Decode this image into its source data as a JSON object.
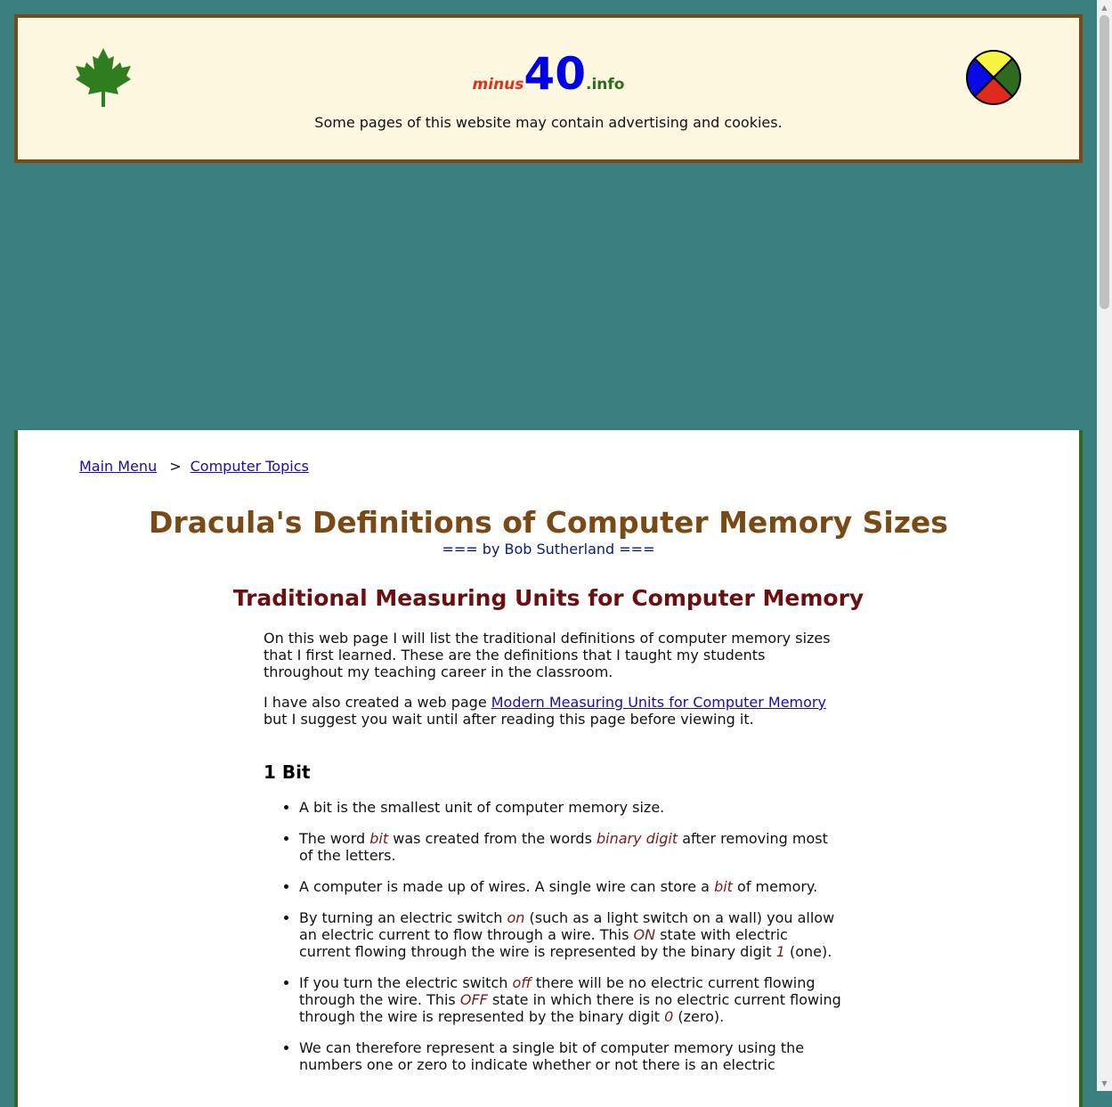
{
  "header": {
    "logo_minus": "minus",
    "logo_forty": "40",
    "logo_info": ".info",
    "notice": "Some pages of this website may contain advertising and cookies.",
    "left_icon": "maple-leaf-icon",
    "right_icon": "medicine-wheel-icon"
  },
  "breadcrumb": {
    "main_menu": "Main Menu",
    "separator": ">",
    "computer_topics": "Computer Topics"
  },
  "article": {
    "title": "Dracula's Definitions of Computer Memory Sizes",
    "byline": "=== by Bob Sutherland ===",
    "section_title": "Traditional Measuring Units for Computer Memory",
    "intro_p1": "On this web page I will list the traditional definitions of computer memory sizes that I first learned. These are the definitions that I taught my students throughout my teaching career in the classroom.",
    "intro_p2_before": "I have also created a web page ",
    "intro_p2_link": "Modern Measuring Units for Computer Memory",
    "intro_p2_after": " but I suggest you wait until after reading this page before viewing it.",
    "subheading": "1 Bit",
    "bullets": {
      "b1": "A bit is the smallest unit of computer memory size.",
      "b2_a": "The word ",
      "b2_em1": "bit",
      "b2_b": " was created from the words ",
      "b2_em2": "binary digit",
      "b2_c": " after removing most of the letters.",
      "b3_a": "A computer is made up of wires. A single wire can store a ",
      "b3_em": "bit",
      "b3_b": " of memory.",
      "b4_a": "By turning an electric switch ",
      "b4_em1": "on",
      "b4_b": " (such as a light switch on a wall) you allow an electric current to flow through a wire. This ",
      "b4_em2": "ON",
      "b4_c": " state with electric current flowing through the wire is represented by the binary digit ",
      "b4_em3": "1",
      "b4_d": " (one).",
      "b5_a": "If you turn the electric switch ",
      "b5_em1": "off",
      "b5_b": " there will be no electric current flowing through the wire. This ",
      "b5_em2": "OFF",
      "b5_c": " state in which there is no electric current flowing through the wire is represented by the binary digit ",
      "b5_em3": "0",
      "b5_d": " (zero).",
      "b6": "We can therefore represent a single bit of computer memory using the numbers one or zero to indicate whether or not there is an electric"
    }
  },
  "colors": {
    "background": "#3a8080",
    "header_bg": "#fef8e0",
    "header_border": "#7a4a16",
    "content_border": "#2e6b1e",
    "title": "#7a4a16",
    "section_title": "#6b0f0f",
    "link": "#1a0dab"
  }
}
